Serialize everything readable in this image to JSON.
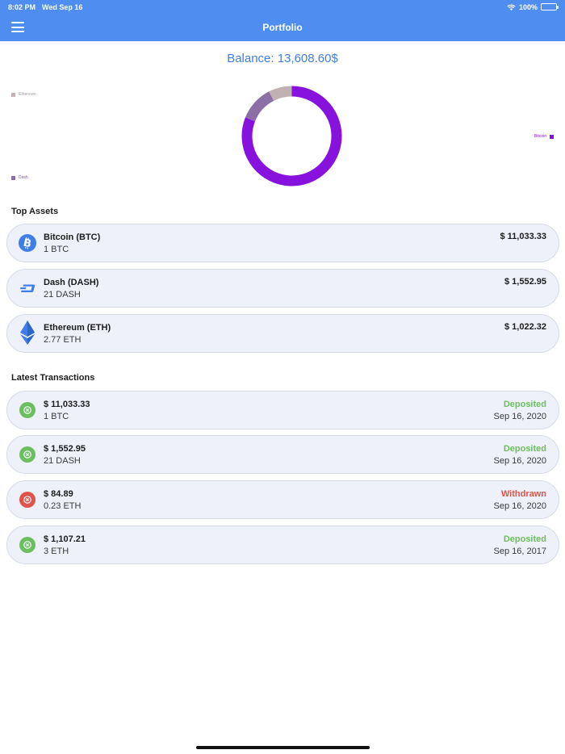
{
  "status_bar": {
    "time": "8:02 PM",
    "date": "Wed Sep 16",
    "battery": "100%"
  },
  "nav": {
    "title": "Portfolio"
  },
  "balance": "Balance: 13,608.60$",
  "chart_data": {
    "type": "pie",
    "categories": [
      "Bitcoin",
      "Dash",
      "Ethereum"
    ],
    "values": [
      11033.33,
      1552.95,
      1022.32
    ],
    "colors": [
      "#8712de",
      "#8d6fa8",
      "#c2b1b3"
    ],
    "legend": [
      "Ethereum",
      "Dash",
      "Bitcoin"
    ]
  },
  "top_assets": {
    "title": "Top Assets",
    "items": [
      {
        "name": "Bitcoin (BTC)",
        "amount": "1 BTC",
        "value": "$ 11,033.33",
        "icon": "bitcoin-icon",
        "color": "#3e7ee8"
      },
      {
        "name": "Dash (DASH)",
        "amount": "21 DASH",
        "value": "$ 1,552.95",
        "icon": "dash-icon",
        "color": "#3e7ee8"
      },
      {
        "name": "Ethereum (ETH)",
        "amount": "2.77 ETH",
        "value": "$ 1,022.32",
        "icon": "ethereum-icon",
        "color": "#3e7ee8"
      }
    ]
  },
  "transactions": {
    "title": "Latest Transactions",
    "items": [
      {
        "value": "$ 11,033.33",
        "amount": "1 BTC",
        "status": "Deposited",
        "date": "Sep 16, 2020",
        "kind": "deposit"
      },
      {
        "value": "$ 1,552.95",
        "amount": "21 DASH",
        "status": "Deposited",
        "date": "Sep 16, 2020",
        "kind": "deposit"
      },
      {
        "value": "$ 84.89",
        "amount": "0.23 ETH",
        "status": "Withdrawn",
        "date": "Sep 16, 2020",
        "kind": "withdraw"
      },
      {
        "value": "$ 1,107.21",
        "amount": "3 ETH",
        "status": "Deposited",
        "date": "Sep 16, 2017",
        "kind": "deposit"
      }
    ]
  },
  "colors": {
    "accent": "#4f8ef0",
    "deposit": "#6cbf5e",
    "withdraw": "#e0524a"
  }
}
